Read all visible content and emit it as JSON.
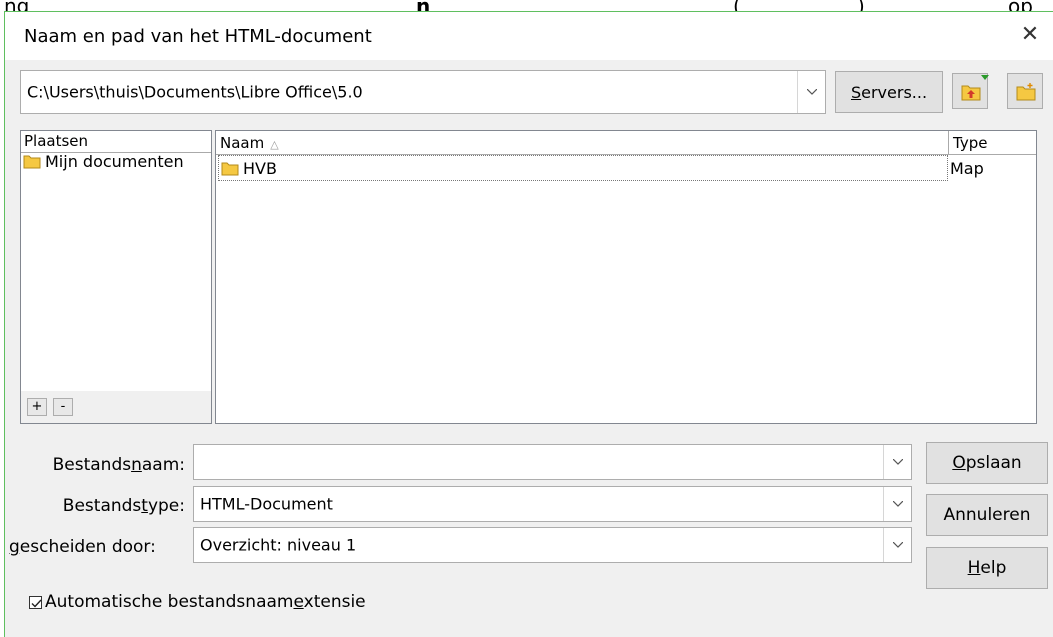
{
  "background": {
    "text_left": "ng",
    "text_bold": "n",
    "paren_open": "(",
    "link": "",
    "paren_close": ")",
    "text_right": "op"
  },
  "dialog": {
    "title": "Naam en pad van het HTML-document",
    "close_icon": "close-icon",
    "path": "C:\\Users\\thuis\\Documents\\Libre Office\\5.0",
    "servers_pre": "",
    "servers_u": "S",
    "servers_post": "ervers...",
    "places": {
      "header": "Plaatsen",
      "items": [
        {
          "label": "Mijn documenten"
        }
      ],
      "add_label": "+",
      "remove_label": "-"
    },
    "files": {
      "col_name": "Naam",
      "col_type": "Type",
      "rows": [
        {
          "name": "HVB",
          "type": "Map"
        }
      ]
    },
    "filename": {
      "label_pre": "Bestands",
      "label_u": "n",
      "label_post": "aam:",
      "value": ""
    },
    "filetype": {
      "label_pre": "Bestands",
      "label_u": "t",
      "label_post": "ype:",
      "value": "HTML-Document"
    },
    "separated": {
      "label_u": "g",
      "label_post": "escheiden door:",
      "value": "Overzicht: niveau 1"
    },
    "buttons": {
      "save_u": "O",
      "save_post": "pslaan",
      "cancel": "Annuleren",
      "help_u": "H",
      "help_post": "elp"
    },
    "auto_ext": {
      "pre": "Automatische bestandsnaam",
      "u": "e",
      "post": "xtensie",
      "checked": true
    }
  },
  "colors": {
    "dialog_bg": "#f0f0f0",
    "button_bg": "#e1e1e1",
    "folder_yellow": "#f5c842",
    "link_green": "#118811",
    "border_green": "#5fbf5f"
  }
}
